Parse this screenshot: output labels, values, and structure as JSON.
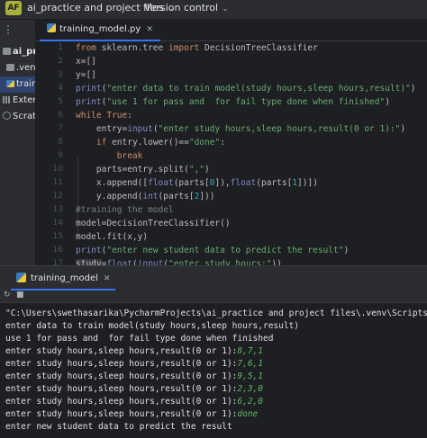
{
  "titlebar": {
    "avatar": "AF",
    "project_name": "ai_practice and project files",
    "vcs_label": "Version control",
    "chevron": "⌄"
  },
  "project_panel": {
    "items": [
      {
        "label": "ai_practi",
        "icon": "folder-icon"
      },
      {
        "label": ".venv",
        "icon": "folder-icon"
      },
      {
        "label": "trainin",
        "icon": "python-file-icon"
      },
      {
        "label": "External",
        "icon": "library-icon"
      },
      {
        "label": "Scratche",
        "icon": "scratches-icon"
      }
    ]
  },
  "editor": {
    "tab_label": "training_model.py",
    "line_numbers": [
      "1",
      "2",
      "3",
      "4",
      "5",
      "6",
      "7",
      "8",
      "9",
      "10",
      "11",
      "12",
      "13",
      "14",
      "15",
      "16",
      "17"
    ]
  },
  "run": {
    "tab_label": "training_model",
    "console": {
      "lines": [
        {
          "text": "\"C:\\Users\\swethasarika\\PycharmProjects\\ai_practice and project files\\.venv\\Scripts\\python.exe\"",
          "input": ""
        },
        {
          "text": "enter data to train model(study hours,sleep hours,result)",
          "input": ""
        },
        {
          "text": "use 1 for pass and  for fail type done when finished",
          "input": ""
        },
        {
          "text": "enter study hours,sleep hours,result(0 or 1):",
          "input": "8,7,1"
        },
        {
          "text": "enter study hours,sleep hours,result(0 or 1):",
          "input": "7,6,1"
        },
        {
          "text": "enter study hours,sleep hours,result(0 or 1):",
          "input": "9,5,1"
        },
        {
          "text": "enter study hours,sleep hours,result(0 or 1):",
          "input": "2,3,0"
        },
        {
          "text": "enter study hours,sleep hours,result(0 or 1):",
          "input": "6,2,0"
        },
        {
          "text": "enter study hours,sleep hours,result(0 or 1):",
          "input": "done"
        },
        {
          "text": "enter new student data to predict the result",
          "input": ""
        }
      ]
    }
  },
  "colors": {
    "keyword": "#cf8e6d",
    "string": "#6aab73",
    "builtin": "#8888c6",
    "number": "#2aacb8",
    "comment": "#7a7e85",
    "console_input": "#5fb865",
    "accent": "#3574f0"
  }
}
